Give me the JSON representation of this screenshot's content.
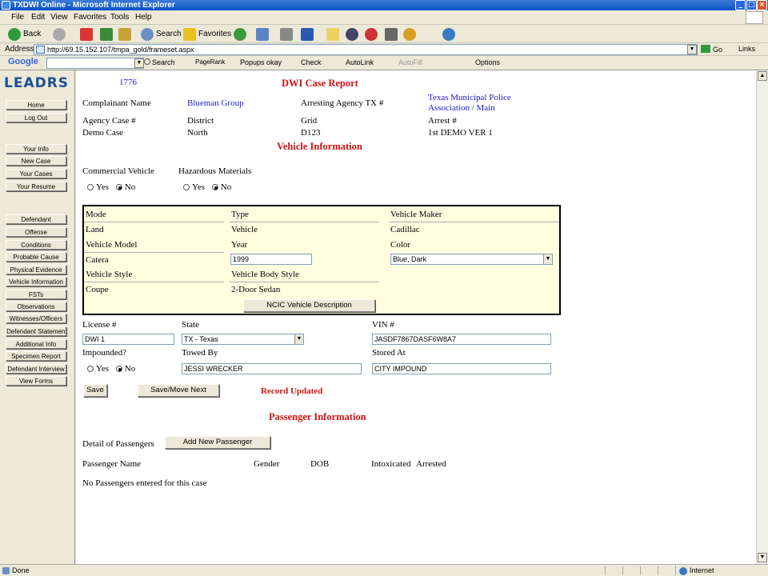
{
  "window": {
    "title": "TXDWI Online - Microsoft Internet Explorer"
  },
  "menu": [
    "File",
    "Edit",
    "View",
    "Favorites",
    "Tools",
    "Help"
  ],
  "toolbar": {
    "back": "Back",
    "search": "Search",
    "favorites": "Favorites"
  },
  "address": {
    "label": "Address",
    "url": "http://69.15.152.107/tmpa_gold/frameset.aspx",
    "go": "Go",
    "links": "Links"
  },
  "google_bar": {
    "brand": "Google",
    "search": "Search",
    "pagerank": "PageRank",
    "popups": "Popups okay",
    "check": "Check",
    "autolink": "AutoLink",
    "autofill": "AutoFill",
    "options": "Options"
  },
  "nav": {
    "logo": "LEADRS",
    "group1": [
      "Home",
      "Log Out"
    ],
    "group2": [
      "Your Info",
      "New Case",
      "Your Cases",
      "Your Resume"
    ],
    "group3": [
      "Defendant",
      "Offense",
      "Conditions",
      "Probable Cause",
      "Physical Evidence",
      "Vehicle Information",
      "FSTs",
      "Observations",
      "Witnesses/Officers",
      "Defendant Statement",
      "Additional Info",
      "Specimen Report",
      "Defendant Interview",
      "View Forms"
    ]
  },
  "header": {
    "case_no": "1776",
    "title": "DWI Case Report",
    "complainant_label": "Complainant Name",
    "complainant_value": "Blueman Group",
    "arresting_label": "Arresting Agency TX #",
    "arresting_value": "Texas Municipal Police Association / Main",
    "agency_case_label": "Agency Case #",
    "district_label": "District",
    "grid_label": "Grid",
    "arrest_label": "Arrest #",
    "agency_case_value": "Demo Case",
    "district_value": "North",
    "grid_value": "D123",
    "arrest_value": "1st DEMO VER 1"
  },
  "vehicle": {
    "section_title": "Vehicle Information",
    "commercial_label": "Commercial Vehicle",
    "hazardous_label": "Hazardous Materials",
    "yes": "Yes",
    "no": "No",
    "mode_label": "Mode",
    "mode_value": "Land",
    "type_label": "Type",
    "type_value": "Vehicle",
    "maker_label": "Vehicle Maker",
    "maker_value": "Cadillac",
    "model_label": "Vehicle Model",
    "model_value": "Catera",
    "year_label": "Year",
    "year_value": "1999",
    "color_label": "Color",
    "color_value": "Blue, Dark",
    "style_label": "Vehicle Style",
    "style_value": "Coupe",
    "body_label": "Vehicle Body Style",
    "body_value": "2-Door Sedan",
    "ncic_button": "NCIC Vehicle Description",
    "license_label": "License #",
    "license_value": "DWI 1",
    "state_label": "State",
    "state_value": "TX - Texas",
    "vin_label": "VIN #",
    "vin_value": "JASDF7867DASF6W8A7",
    "impounded_label": "Impounded?",
    "towed_label": "Towed By",
    "towed_value": "JESSI WRECKER",
    "stored_label": "Stored At",
    "stored_value": "CITY IMPOUND",
    "save_button": "Save",
    "save_move_button": "Save/Move Next",
    "status_message": "Record Updated"
  },
  "passengers": {
    "section_title": "Passenger Information",
    "detail_label": "Detail of Passengers",
    "add_button": "Add New Passenger",
    "columns": [
      "Passenger Name",
      "Gender",
      "DOB",
      "Intoxicated",
      "Arrested"
    ],
    "empty_message": "No Passengers entered for this case"
  },
  "status": {
    "left": "Done",
    "zone": "Internet"
  }
}
